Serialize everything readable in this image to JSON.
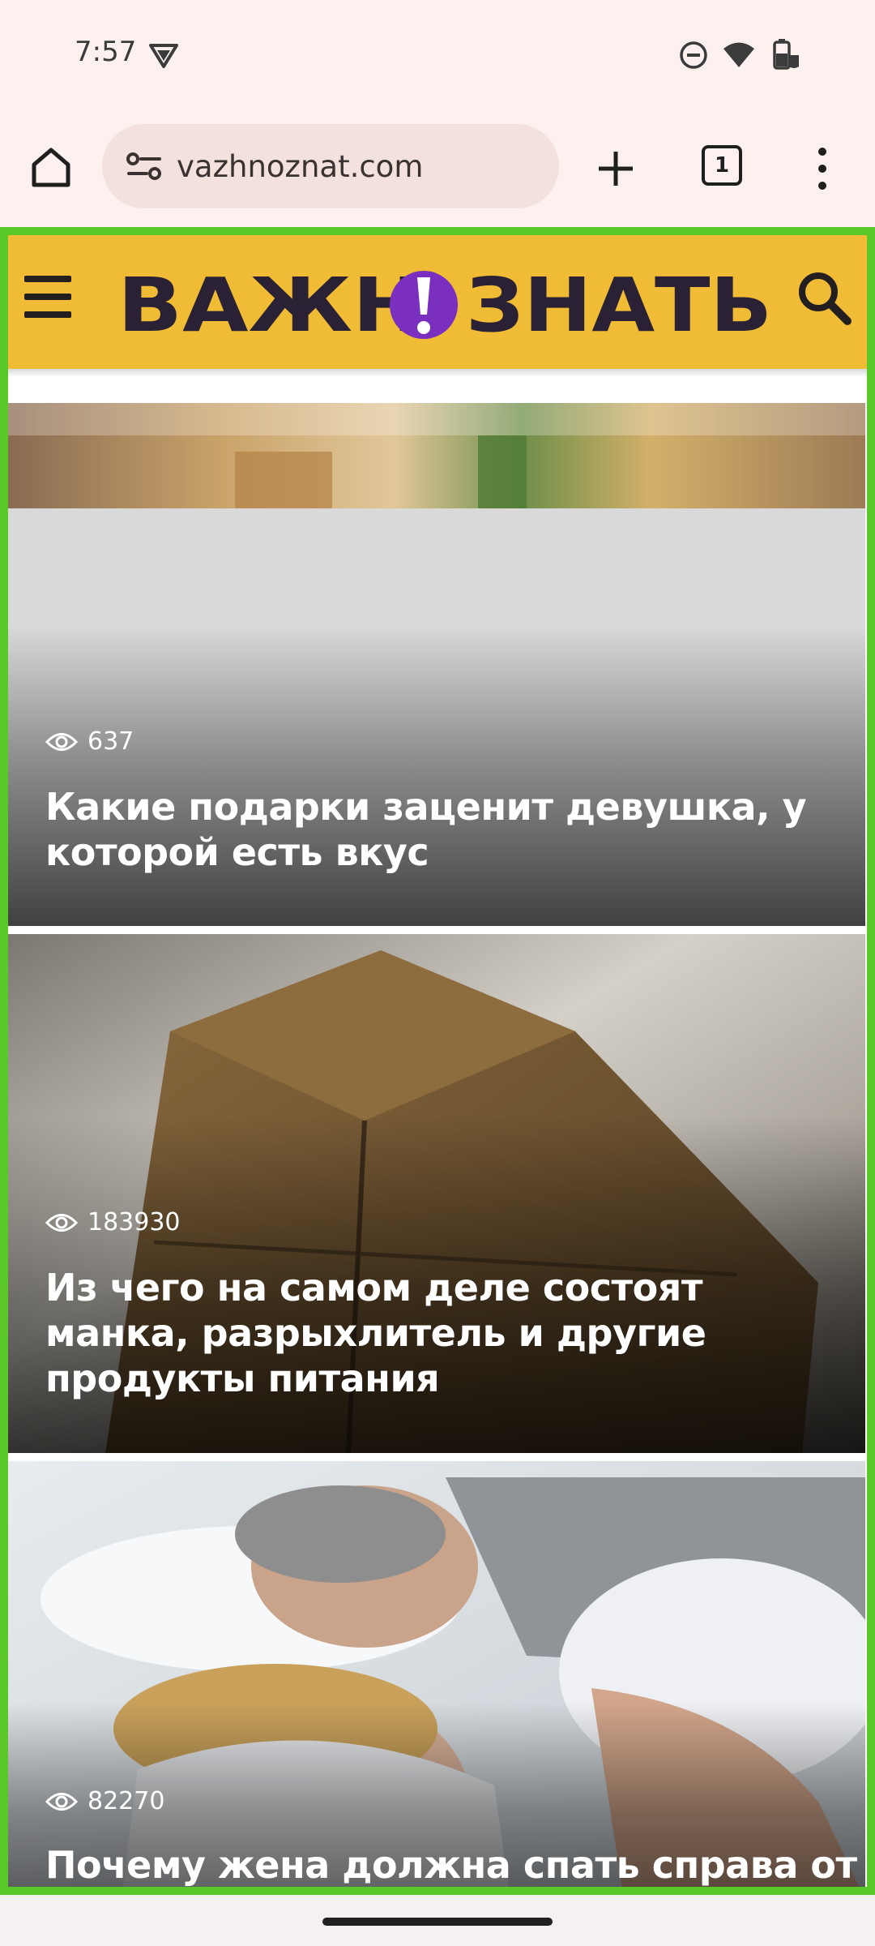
{
  "status_bar": {
    "time": "7:57"
  },
  "browser": {
    "url": "vazhnoznat.com",
    "tab_count": "1"
  },
  "site": {
    "logo_text": "ВАЖНО ЗНАТЬ",
    "brand_color": "#f0bc36",
    "accent_color": "#7b2fbe"
  },
  "articles": [
    {
      "views": "637",
      "title": "Какие подарки заценит девушка, у которой есть вкус"
    },
    {
      "views": "183930",
      "title": "Из чего на самом деле состоят манка, разрыхлитель и другие продукты питания"
    },
    {
      "views": "82270",
      "title": "Почему жена должна спать справа от"
    }
  ]
}
